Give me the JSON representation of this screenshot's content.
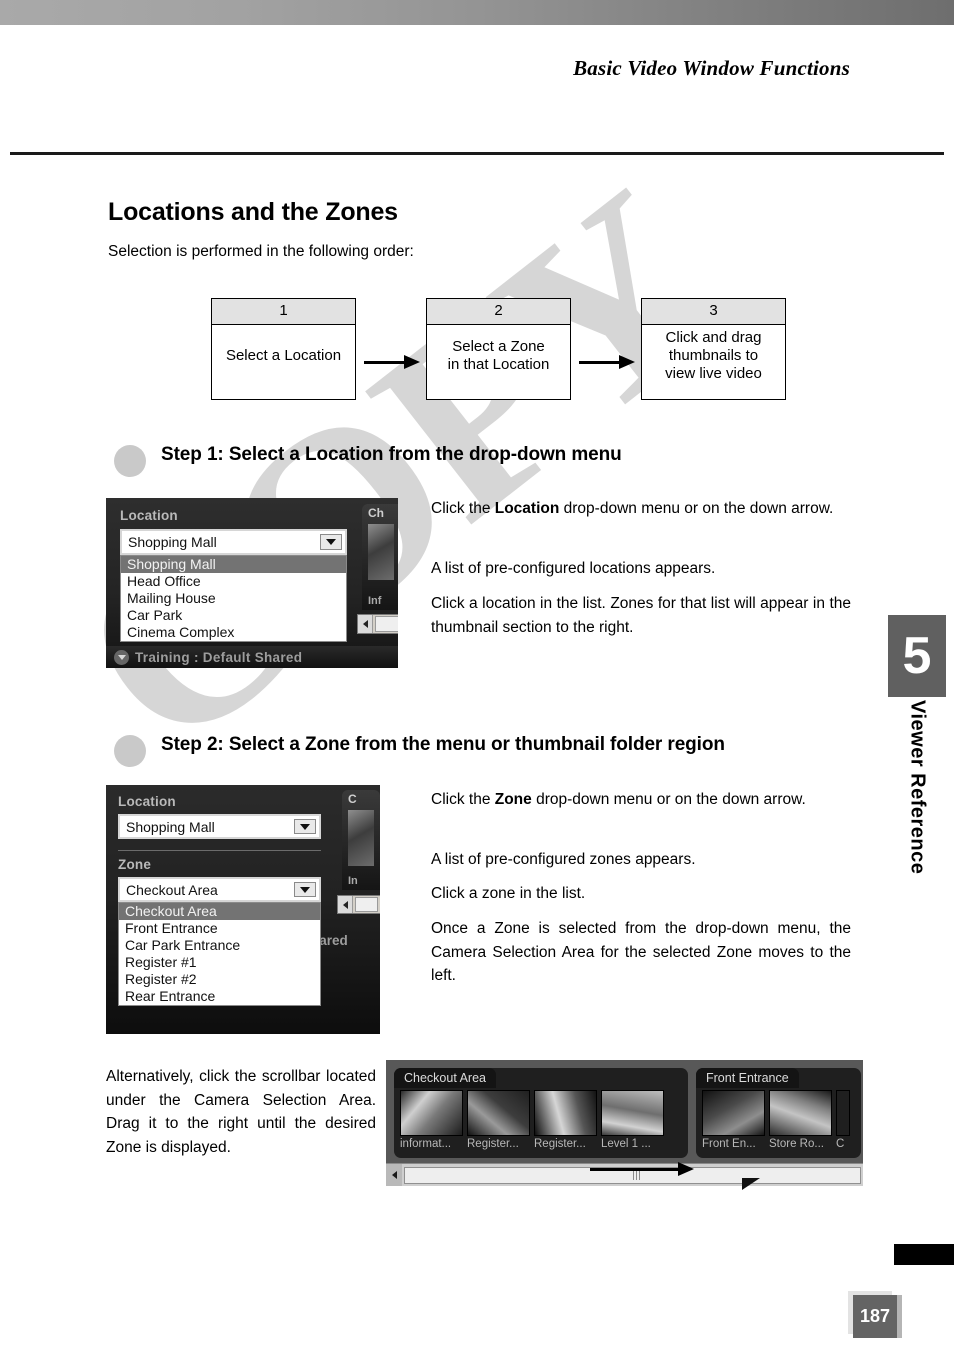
{
  "header": {
    "running_head": "Basic Video Window Functions"
  },
  "page": {
    "heading": "Locations and the Zones",
    "intro": "Selection is performed in the following order:",
    "watermark": "COPY",
    "number": "187"
  },
  "chapter": {
    "number": "5",
    "label": "Viewer Reference"
  },
  "flow": {
    "boxes": [
      {
        "num": "1",
        "text": "Select a Location"
      },
      {
        "num": "2",
        "text": "Select a Zone\nin that Location"
      },
      {
        "num": "3",
        "text": "Click and drag\nthumbnails to\nview live video"
      }
    ]
  },
  "step1": {
    "title": "Step 1: Select a Location from the drop-down menu",
    "paragraphs": [
      "Click the Location drop-down menu or on the down arrow.",
      "A list of pre-configured locations appears.",
      "Click a location in the list. Zones for that list will appear in the thumbnail section to the right."
    ],
    "p1_pre": "Click the ",
    "p1_bold": "Location",
    "p1_post": " drop-down menu or on the down arrow.",
    "screenshot": {
      "location_label": "Location",
      "location_value": "Shopping Mall",
      "location_options": [
        "Shopping Mall",
        "Head Office",
        "Mailing House",
        "Car Park",
        "Cinema Complex"
      ],
      "panel_caption": "Ch",
      "panel_caption2": "Inf",
      "taskbar_text": "Training : Default Shared"
    }
  },
  "step2": {
    "title": "Step 2: Select a Zone from the menu or thumbnail folder region",
    "p1_pre": "Click the ",
    "p1_bold": "Zone",
    "p1_post": " drop-down menu or on the down arrow.",
    "paragraphs": [
      "A list of pre-configured zones appears.",
      "Click a zone in the list.",
      "Once a Zone is selected from the drop-down menu, the Camera Selection Area for the selected Zone moves to the left."
    ],
    "screenshot": {
      "location_label": "Location",
      "location_value": "Shopping Mall",
      "zone_label": "Zone",
      "zone_value": "Checkout Area",
      "zone_options": [
        "Checkout Area",
        "Front Entrance",
        "Car Park Entrance",
        "Register #1",
        "Register #2",
        "Rear Entrance"
      ],
      "panel_caption": "C",
      "panel_caption2": "In",
      "taskbar_text": "hared"
    }
  },
  "alternative": {
    "text": "Alternatively, click the scrollbar located under the Camera Selection Area. Drag it to the right until the desired Zone is displayed.",
    "screenshot": {
      "folders": [
        {
          "name": "Checkout Area",
          "cameras": [
            "informat...",
            "Register...",
            "Register...",
            "Level 1 ..."
          ]
        },
        {
          "name": "Front Entrance",
          "cameras": [
            "Front En...",
            "Store Ro...",
            "C"
          ]
        }
      ]
    }
  },
  "colors": {
    "watermark": "#d6d6d6",
    "chapter_tab": "#606060",
    "page_num_bg": "#646464",
    "flow_header": "#e2e2e2"
  }
}
